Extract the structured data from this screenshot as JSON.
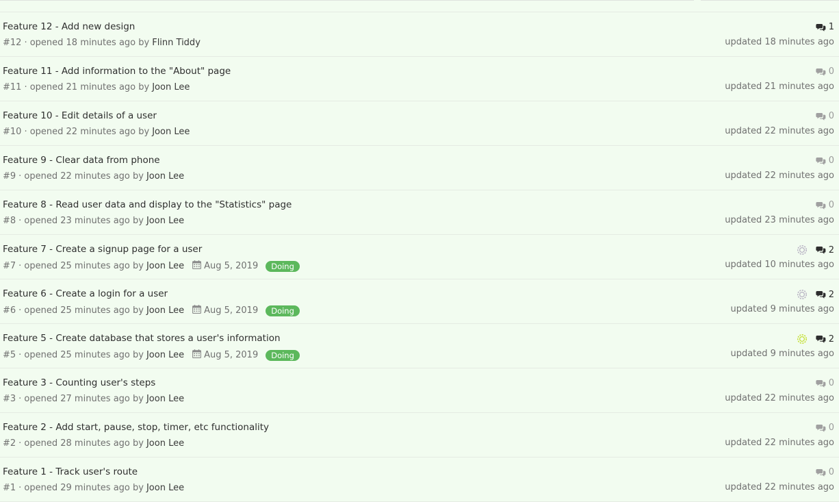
{
  "issues": [
    {
      "title": "Feature 12 - Add new design",
      "ref": "#12",
      "opened": "· opened 18 minutes ago by",
      "author": "Flinn Tiddy",
      "due": "",
      "label": "",
      "pipeline": "",
      "comments": "1",
      "updated": "updated 18 minutes ago"
    },
    {
      "title": "Feature 11 - Add information to the \"About\" page",
      "ref": "#11",
      "opened": "· opened 21 minutes ago by",
      "author": "Joon Lee",
      "due": "",
      "label": "",
      "pipeline": "",
      "comments": "0",
      "updated": "updated 21 minutes ago"
    },
    {
      "title": "Feature 10 - Edit details of a user",
      "ref": "#10",
      "opened": "· opened 22 minutes ago by",
      "author": "Joon Lee",
      "due": "",
      "label": "",
      "pipeline": "",
      "comments": "0",
      "updated": "updated 22 minutes ago"
    },
    {
      "title": "Feature 9 - Clear data from phone",
      "ref": "#9",
      "opened": "· opened 22 minutes ago by",
      "author": "Joon Lee",
      "due": "",
      "label": "",
      "pipeline": "",
      "comments": "0",
      "updated": "updated 22 minutes ago"
    },
    {
      "title": "Feature 8 - Read user data and display to the \"Statistics\" page",
      "ref": "#8",
      "opened": "· opened 23 minutes ago by",
      "author": "Joon Lee",
      "due": "",
      "label": "",
      "pipeline": "",
      "comments": "0",
      "updated": "updated 23 minutes ago"
    },
    {
      "title": "Feature 7 - Create a signup page for a user",
      "ref": "#7",
      "opened": "· opened 25 minutes ago by",
      "author": "Joon Lee",
      "due": "Aug 5, 2019",
      "label": "Doing",
      "pipeline": "pending",
      "comments": "2",
      "updated": "updated 10 minutes ago"
    },
    {
      "title": "Feature 6 - Create a login for a user",
      "ref": "#6",
      "opened": "· opened 25 minutes ago by",
      "author": "Joon Lee",
      "due": "Aug 5, 2019",
      "label": "Doing",
      "pipeline": "pending",
      "comments": "2",
      "updated": "updated 9 minutes ago"
    },
    {
      "title": "Feature 5 - Create database that stores a user's information",
      "ref": "#5",
      "opened": "· opened 25 minutes ago by",
      "author": "Joon Lee",
      "due": "Aug 5, 2019",
      "label": "Doing",
      "pipeline": "warning",
      "comments": "2",
      "updated": "updated 9 minutes ago"
    },
    {
      "title": "Feature 3 - Counting user's steps",
      "ref": "#3",
      "opened": "· opened 27 minutes ago by",
      "author": "Joon Lee",
      "due": "",
      "label": "",
      "pipeline": "",
      "comments": "0",
      "updated": "updated 22 minutes ago"
    },
    {
      "title": "Feature 2 - Add start, pause, stop, timer, etc functionality",
      "ref": "#2",
      "opened": "· opened 28 minutes ago by",
      "author": "Joon Lee",
      "due": "",
      "label": "",
      "pipeline": "",
      "comments": "0",
      "updated": "updated 22 minutes ago"
    },
    {
      "title": "Feature 1 - Track user's route",
      "ref": "#1",
      "opened": "· opened 29 minutes ago by",
      "author": "Joon Lee",
      "due": "",
      "label": "",
      "pipeline": "",
      "comments": "0",
      "updated": "updated 22 minutes ago"
    }
  ],
  "icons": {
    "comment": "comments-icon",
    "calendar": "calendar-icon",
    "pipeline_pending": "pipeline-pending-icon",
    "pipeline_warning": "pipeline-warning-icon"
  },
  "colors": {
    "background": "#f2fcf0",
    "label_doing": "#5cb85c",
    "pipeline_pending": "#b9b4c4",
    "pipeline_warning": "#c6e03a"
  }
}
